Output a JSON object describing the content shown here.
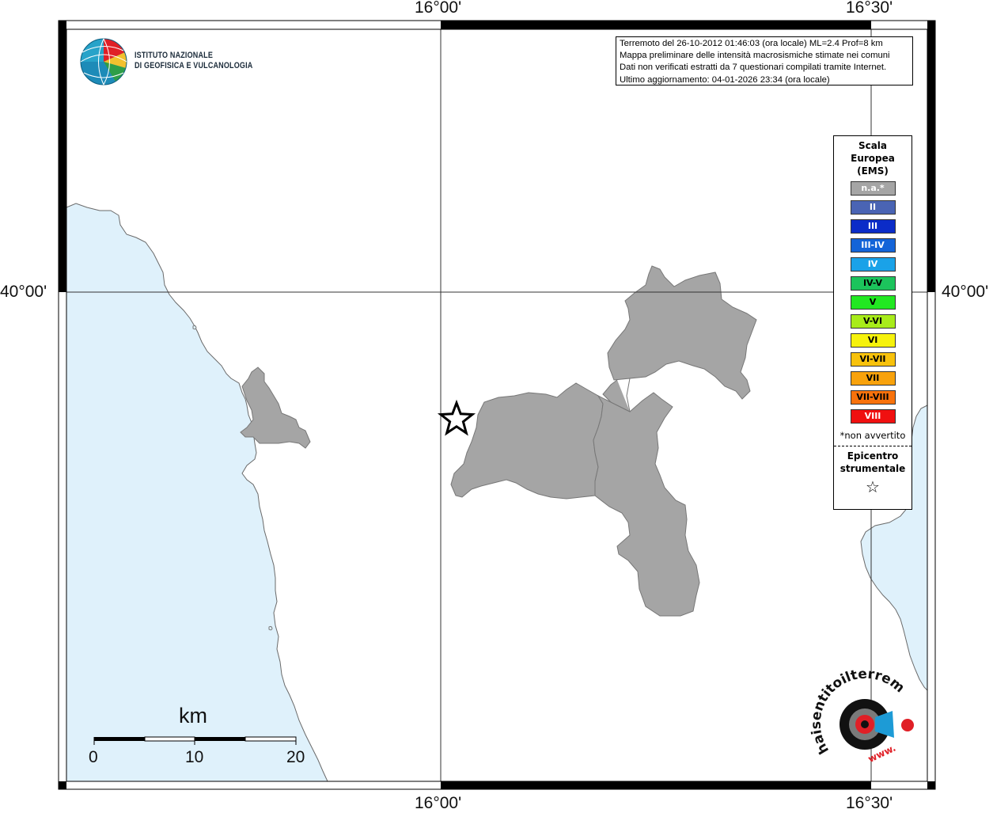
{
  "map": {
    "ticks": {
      "lon_top_left": "16°00'",
      "lon_top_right": "16°30'",
      "lon_bottom_left": "16°00'",
      "lon_bottom_right": "16°30'",
      "lat_left": "40°00'",
      "lat_right": "40°00'"
    },
    "colors": {
      "sea": "#dff1fb",
      "land": "#ffffff",
      "municipality": "#a5a5a5"
    }
  },
  "logo": {
    "line1": "ISTITUTO NAZIONALE",
    "line2": "DI GEOFISICA E VULCANOLOGIA"
  },
  "info": {
    "line1": "Terremoto del 26-10-2012 01:46:03 (ora locale) ML=2.4 Prof=8 km",
    "line2": "Mappa preliminare delle intensità macrosismiche stimate nei comuni",
    "line3": "Dati non verificati estratti da 7 questionari compilati tramite Internet.",
    "line4": "Ultimo aggiornamento: 04-01-2026 23:34 (ora locale)"
  },
  "legend": {
    "title_line1": "Scala",
    "title_line2": "Europea",
    "title_line3": "(EMS)",
    "classes": [
      {
        "label": "n.a.*",
        "color": "#a5a5a5"
      },
      {
        "label": "II",
        "color": "#4a64b4"
      },
      {
        "label": "III",
        "color": "#0b2cc8"
      },
      {
        "label": "III-IV",
        "color": "#1464d8"
      },
      {
        "label": "IV",
        "color": "#1aa2e8"
      },
      {
        "label": "IV-V",
        "color": "#1cc45c"
      },
      {
        "label": "V",
        "color": "#22e822"
      },
      {
        "label": "V-VI",
        "color": "#a8ec1a"
      },
      {
        "label": "VI",
        "color": "#f6f20c"
      },
      {
        "label": "VI-VII",
        "color": "#f8c20c"
      },
      {
        "label": "VII",
        "color": "#f8a20c"
      },
      {
        "label": "VII-VIII",
        "color": "#f8720c"
      },
      {
        "label": "VIII",
        "color": "#f01010"
      }
    ],
    "note": "*non avvertito",
    "epicenter_line1": "Epicentro",
    "epicenter_line2": "strumentale",
    "epicenter_symbol": "☆"
  },
  "scale": {
    "title": "km",
    "labels": [
      "0",
      "10",
      "20"
    ]
  },
  "watermark": {
    "text_top": "haisentitoilterremoto.it",
    "text_bottom": "www."
  }
}
